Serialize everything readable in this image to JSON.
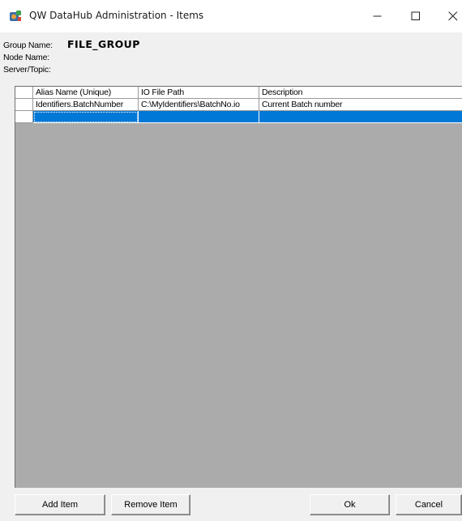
{
  "window": {
    "title": "QW DataHub Administration - Items",
    "app_icon": "datahub-app-icon",
    "controls": {
      "minimize": "minimize-icon",
      "maximize": "maximize-icon",
      "close": "close-icon"
    }
  },
  "info": {
    "group_label": "Group Name:",
    "group_value": "FILE_GROUP",
    "node_label": "Node Name:",
    "server_label": "Server/Topic:"
  },
  "grid": {
    "columns": [
      "Alias Name (Unique)",
      "IO File Path",
      "Description"
    ],
    "rows": [
      [
        "Identifiers.BatchNumber",
        "C:\\MyIdentifiers\\BatchNo.io",
        "Current Batch number"
      ],
      [
        "",
        "",
        ""
      ]
    ],
    "selected_row": 1,
    "colors": {
      "selection": "#0078d7",
      "empty_area": "#ababab"
    }
  },
  "buttons": {
    "add": "Add Item",
    "remove": "Remove Item",
    "ok": "Ok",
    "cancel": "Cancel"
  }
}
